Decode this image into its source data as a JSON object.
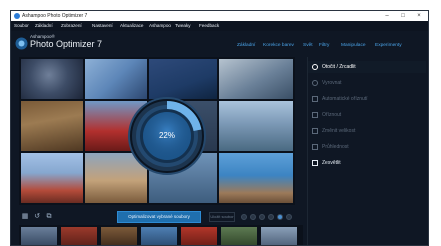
{
  "window": {
    "title": "Ashampoo Photo Optimizer 7",
    "minimize_glyph": "–",
    "maximize_glyph": "□",
    "close_glyph": "×"
  },
  "menubar": {
    "items": [
      "Soubor",
      "Základní",
      "Zobrazení",
      "Nastavení",
      "Aktualizace",
      "Ashampoo",
      "Tweaky",
      "Feedback"
    ]
  },
  "header": {
    "company": "Ashampoo®",
    "product": "Photo Optimizer 7",
    "tabs": [
      "Základní",
      "Korekce barev",
      "Svět",
      "Filtry",
      "Manipulace",
      "Experimenty"
    ]
  },
  "progress": {
    "value": 0.22,
    "label": "22%"
  },
  "panel": {
    "items": [
      {
        "label": "Otočit / Zrcadlit",
        "icon": "rotate-icon",
        "state": "active"
      },
      {
        "label": "Vyrovnat",
        "icon": "straighten-icon",
        "state": "dim"
      },
      {
        "label": "Automatické oříznutí",
        "icon": "autocrop-icon",
        "state": "dim"
      },
      {
        "label": "Oříznout",
        "icon": "crop-icon",
        "state": "dim"
      },
      {
        "label": "Změnit velikost",
        "icon": "resize-icon",
        "state": "dim"
      },
      {
        "label": "Průhlednost",
        "icon": "transparency-icon",
        "state": "dim"
      },
      {
        "label": "Zesvětlit",
        "icon": "brighten-icon",
        "state": "bright"
      }
    ]
  },
  "toolbar": {
    "optimize_label": "Optimalizovat vybrané soubory",
    "ghost_label": "Uložit soubor",
    "tool_icons": [
      "select-all-icon",
      "undo-icon",
      "crop-tool-icon"
    ]
  },
  "colors": {
    "accent": "#1f6fae",
    "tab_text": "#4aa3e8",
    "background": "#0f1724"
  }
}
